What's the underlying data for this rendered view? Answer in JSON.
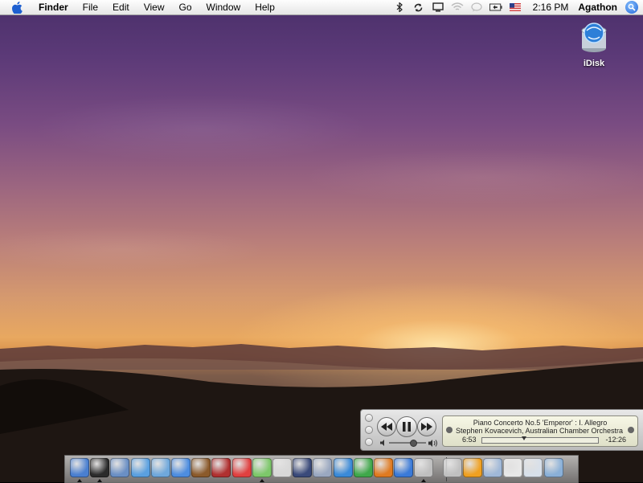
{
  "menubar": {
    "app_name": "Finder",
    "menus": [
      "File",
      "Edit",
      "View",
      "Go",
      "Window",
      "Help"
    ],
    "clock": "2:16 PM",
    "user": "Agathon",
    "status_icons": [
      "bluetooth-icon",
      "sync-icon",
      "display-icon",
      "wifi-icon",
      "ichat-icon",
      "battery-icon",
      "flag-us-icon",
      "spotlight-icon"
    ]
  },
  "desktop": {
    "icons": [
      {
        "label": "iDisk",
        "icon": "idisk-icon"
      }
    ]
  },
  "itunes_mini": {
    "track": "Piano Concerto No.5 'Emperor' : I. Allegro",
    "artist": "Stephen Kovacevich, Australian Chamber Orchestra",
    "elapsed": "6:53",
    "remaining": "-12:26",
    "progress": 0.36,
    "volume": 0.65
  },
  "dock": {
    "apps": [
      {
        "name": "finder-icon",
        "color": "#4a7fd0",
        "running": true
      },
      {
        "name": "dashboard-icon",
        "color": "#2b2b2b",
        "running": true
      },
      {
        "name": "mail-icon",
        "color": "#6a8fc4",
        "running": false
      },
      {
        "name": "safari-icon",
        "color": "#5aa0e0",
        "running": false
      },
      {
        "name": "network-icon",
        "color": "#6fa8dc",
        "running": false
      },
      {
        "name": "ichat-icon",
        "color": "#4d8de0",
        "running": false
      },
      {
        "name": "address-book-icon",
        "color": "#8b5a2b",
        "running": false
      },
      {
        "name": "dictionary-icon",
        "color": "#b03030",
        "running": false
      },
      {
        "name": "ical-icon",
        "color": "#e04040",
        "running": false
      },
      {
        "name": "itunes-icon",
        "color": "#7dc86a",
        "running": true
      },
      {
        "name": "preview-icon",
        "color": "#d8d8d8",
        "running": false
      },
      {
        "name": "xcode-icon",
        "color": "#3a4a7a",
        "running": false
      },
      {
        "name": "automator-icon",
        "color": "#9aa8c0",
        "running": false
      },
      {
        "name": "sound-icon",
        "color": "#3a8ad8",
        "running": false
      },
      {
        "name": "tool-icon",
        "color": "#3fa84a",
        "running": false
      },
      {
        "name": "player-icon",
        "color": "#e07a20",
        "running": false
      },
      {
        "name": "quicktime-icon",
        "color": "#3a7ad8",
        "running": false
      },
      {
        "name": "system-preferences-icon",
        "color": "#bfbfbf",
        "running": true
      },
      {
        "name": "x11-icon",
        "color": "#c0c0c0",
        "running": false
      },
      {
        "name": "home-folder-icon",
        "color": "#f0a020",
        "running": false
      },
      {
        "name": "applications-folder-icon",
        "color": "#a0b8d8",
        "running": false
      },
      {
        "name": "documents-icon",
        "color": "#e8e8e8",
        "running": false
      },
      {
        "name": "web-page-icon",
        "color": "#d8e0ea",
        "running": false
      },
      {
        "name": "trash-icon",
        "color": "#8ab0d8",
        "running": false
      }
    ]
  }
}
